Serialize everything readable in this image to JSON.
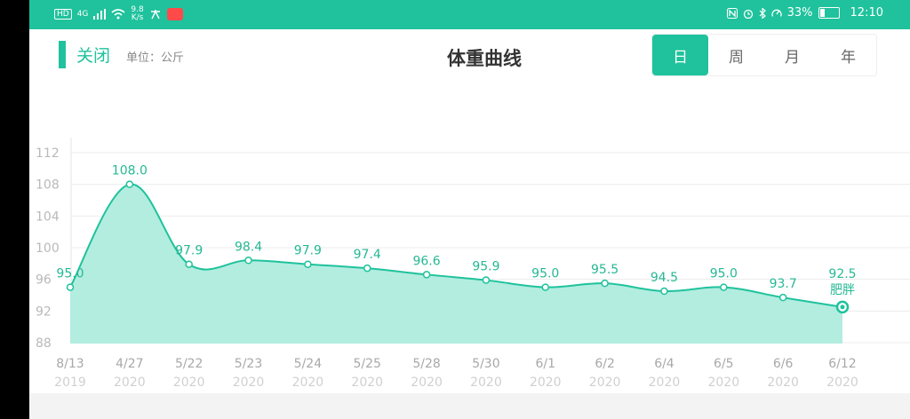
{
  "status_bar": {
    "hd_badge": "HD",
    "network": "4G",
    "speed_value": "9.8",
    "speed_unit": "K/s",
    "battery_percent": "33%",
    "battery_level": 0.33,
    "time": "12:10",
    "background_color": "#1fc29c"
  },
  "header": {
    "close_label": "关闭",
    "unit_label": "单位：公斤",
    "title": "体重曲线",
    "accent_color": "#1fc29c",
    "tabs": [
      {
        "label": "日",
        "active": true
      },
      {
        "label": "周",
        "active": false
      },
      {
        "label": "月",
        "active": false
      },
      {
        "label": "年",
        "active": false
      }
    ]
  },
  "chart_data": {
    "type": "area",
    "y_ticks": [
      112,
      108,
      104,
      100,
      96,
      92,
      88
    ],
    "ylim": [
      87,
      113
    ],
    "x": [
      "8/13",
      "4/27",
      "5/22",
      "5/23",
      "5/24",
      "5/25",
      "5/28",
      "5/30",
      "6/1",
      "6/2",
      "6/4",
      "6/5",
      "6/6",
      "6/12"
    ],
    "years": [
      "2019",
      "2020",
      "2020",
      "2020",
      "2020",
      "2020",
      "2020",
      "2020",
      "2020",
      "2020",
      "2020",
      "2020",
      "2020",
      "2020"
    ],
    "series": [
      {
        "values": [
          95.0,
          108.0,
          97.9,
          98.4,
          97.9,
          97.4,
          96.6,
          95.9,
          95.0,
          95.5,
          94.5,
          95.0,
          93.7,
          92.5
        ],
        "labels": [
          "95.0",
          "108.0",
          "97.9",
          "98.4",
          "97.9",
          "97.4",
          "96.6",
          "95.9",
          "95.0",
          "95.5",
          "94.5",
          "95.0",
          "93.7",
          "92.5"
        ]
      }
    ],
    "last_point_annotation": "肥胖",
    "line_color": "#1fc29c",
    "fill_color": "#b2ede0",
    "grid": true
  }
}
